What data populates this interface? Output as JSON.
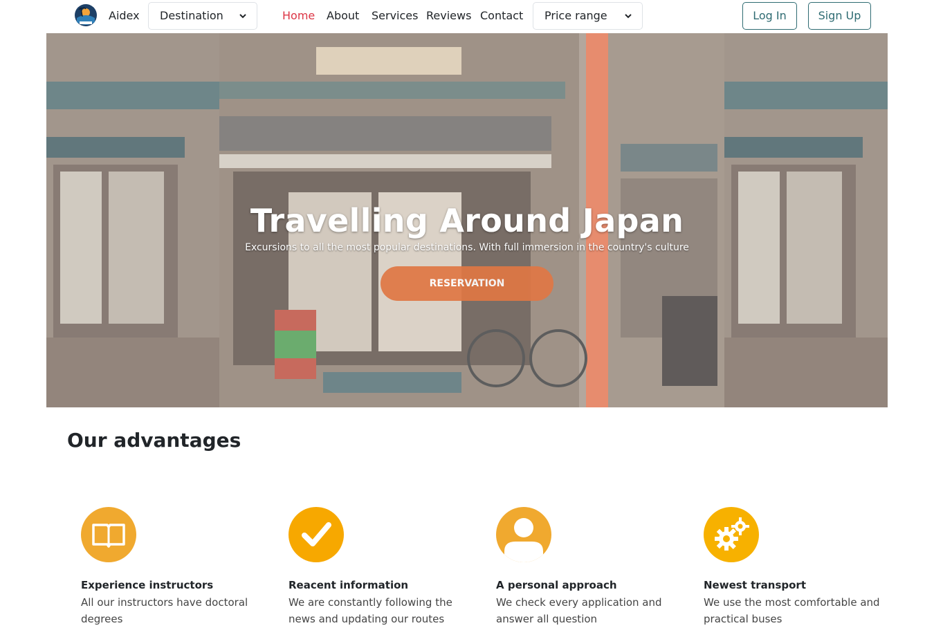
{
  "nav": {
    "brand": "Aidex",
    "destination_select": "Destination",
    "links": [
      "Home",
      "About",
      "Services",
      "Reviews",
      "Contact"
    ],
    "active_link": "Home",
    "price_select": "Price range",
    "login": "Log In",
    "signup": "Sign Up"
  },
  "hero": {
    "title": "Travelling Around Japan",
    "subtitle": "Excursions to all the most popular destinations. With full immersion in the country's culture",
    "button": "RESERVATION"
  },
  "advantages": {
    "title": "Our advantages",
    "items": [
      {
        "icon": "book-icon",
        "title": "Experience instructors",
        "text": "All our instructors have doctoral degrees"
      },
      {
        "icon": "checkmark-icon",
        "title": "Reacent information",
        "text": "We are constantly following the news and updating our routes"
      },
      {
        "icon": "user-icon",
        "title": "A personal approach",
        "text": "We check every application and answer all question"
      },
      {
        "icon": "gears-icon",
        "title": "Newest transport",
        "text": "We use the most comfortable and practical buses"
      }
    ]
  },
  "colors": {
    "accent_red": "#dc3545",
    "teal": "#2e6b72",
    "orange": "#f0a92f",
    "hero_button": "#e07744"
  }
}
